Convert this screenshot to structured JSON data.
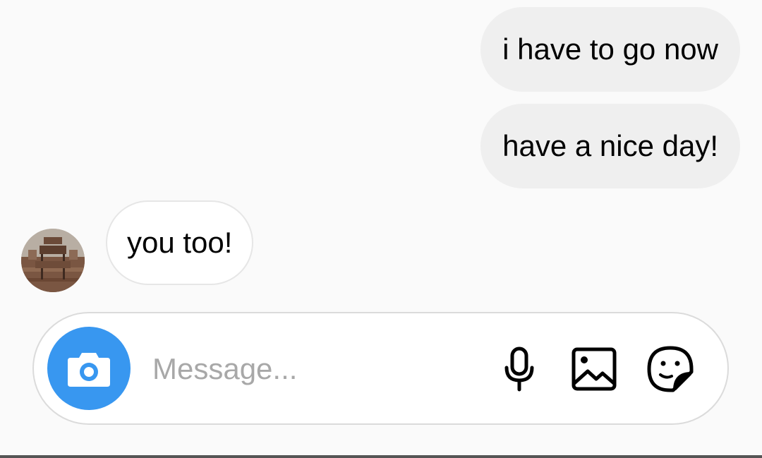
{
  "thread": {
    "outgoing": [
      {
        "text": "i have to go now"
      },
      {
        "text": "have a nice day!"
      }
    ],
    "incoming": [
      {
        "text": "you too!"
      }
    ]
  },
  "composer": {
    "placeholder": "Message...",
    "camera_icon": "camera-icon",
    "mic_icon": "microphone-icon",
    "gallery_icon": "gallery-icon",
    "sticker_icon": "sticker-icon",
    "accent_color": "#3897f0"
  }
}
